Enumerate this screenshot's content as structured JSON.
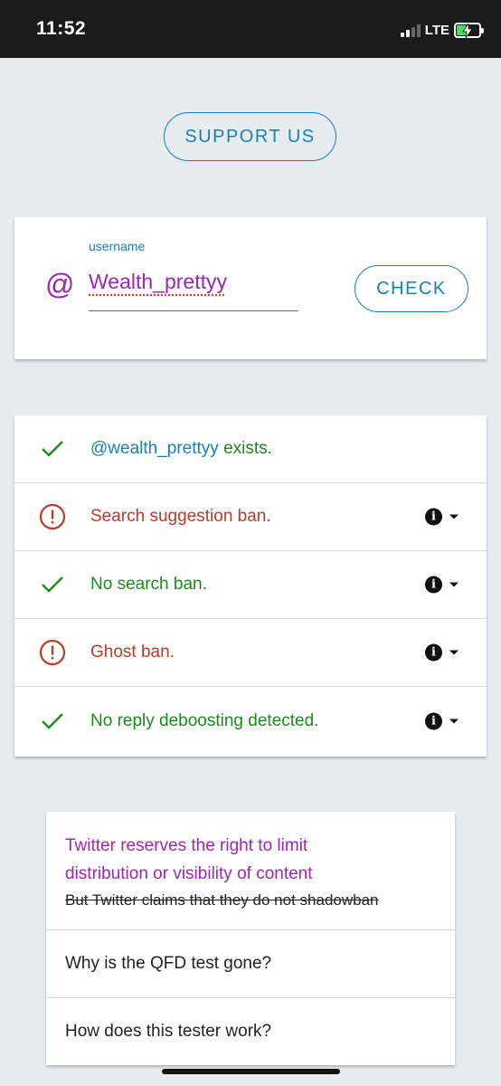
{
  "status_bar": {
    "time": "11:52",
    "network": "LTE",
    "signal_bars_filled": 2,
    "signal_bars_total": 4
  },
  "support_button": {
    "label": "SUPPORT US"
  },
  "username_card": {
    "at_symbol": "@",
    "field_label": "username",
    "field_value": "Wealth_prettyy",
    "check_label": "CHECK"
  },
  "results": [
    {
      "status": "ok",
      "handle": "@wealth_prettyy",
      "text": " exists.",
      "has_info": false
    },
    {
      "status": "ban",
      "text": "Search suggestion ban.",
      "has_info": true
    },
    {
      "status": "ok",
      "text": "No search ban.",
      "has_info": true
    },
    {
      "status": "ban",
      "text": "Ghost ban.",
      "has_info": true
    },
    {
      "status": "ok",
      "text": "No reply deboosting detected.",
      "has_info": true
    }
  ],
  "faq": {
    "item1_line1": "Twitter reserves the right to limit",
    "item1_line2": "distribution or visibility of content",
    "item1_strike": "But Twitter claims that they do not shadowban",
    "item2": "Why is the QFD test gone?",
    "item3": "How does this tester work?"
  },
  "colors": {
    "accent_blue": "#1a7fb5",
    "purple": "#9c27b0",
    "ok_green": "#1e8a1e",
    "ban_red": "#c0392b",
    "background": "#e7ecf0"
  }
}
